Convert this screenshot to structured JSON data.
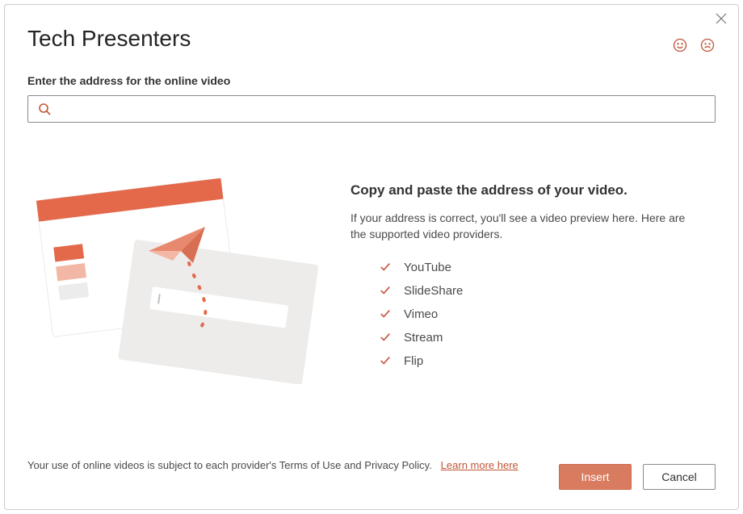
{
  "header": {
    "title": "Tech Presenters"
  },
  "prompt_label": "Enter the address for the online video",
  "search": {
    "value": "",
    "placeholder": ""
  },
  "info": {
    "heading": "Copy and paste the address of your video.",
    "subtext": "If your address is correct, you'll see a video preview here. Here are the supported video providers.",
    "providers": [
      "YouTube",
      "SlideShare",
      "Vimeo",
      "Stream",
      "Flip"
    ]
  },
  "footer": {
    "terms_text": "Your use of online videos is subject to each provider's Terms of Use and Privacy Policy.",
    "learn_more_label": "Learn more here",
    "insert_label": "Insert",
    "cancel_label": "Cancel"
  },
  "icons": {
    "close": "close-icon",
    "happy": "smile-icon",
    "sad": "frown-icon",
    "search": "search-icon",
    "check": "check-icon"
  },
  "colors": {
    "accent": "#c15537",
    "primary_btn": "#d87b5f"
  }
}
